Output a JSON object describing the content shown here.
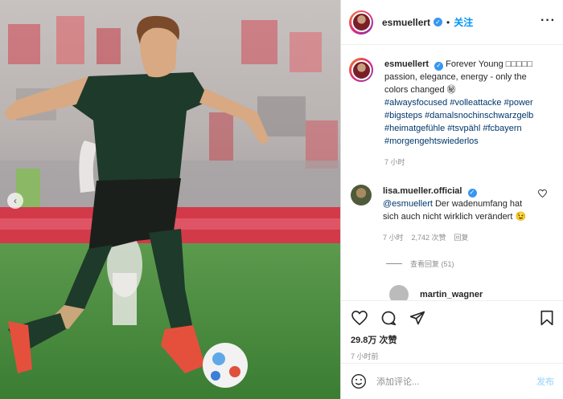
{
  "post_header": {
    "username": "esmuellert",
    "follow_label": "关注",
    "separator": "•",
    "more": "···"
  },
  "caption": {
    "username": "esmuellert",
    "text": "Forever Young □□□□□ passion, elegance, energy - only the colors changed ㊙",
    "hashtags": [
      "#alwaysfocused",
      "#volleattacke",
      "#power",
      "#bigsteps",
      "#damalsnochinschwarzgelb",
      "#heimatgefühle",
      "#tsvpähl",
      "#fcbayern",
      "#morgengehtswiederlos"
    ],
    "time": "7 小时"
  },
  "comment": {
    "username": "lisa.mueller.official",
    "mention": "@esmuellert",
    "text": "Der wadenumfang hat sich auch nicht wirklich verändert 😉",
    "time": "7 小时",
    "likes": "2,742 次赞",
    "reply": "回复",
    "view_replies": "查看回复 (51)"
  },
  "next_comment": {
    "username": "martin_wagner"
  },
  "actions": {
    "likes": "29.8万 次赞",
    "time_ago": "7 小时前"
  },
  "add_comment": {
    "placeholder": "添加评论...",
    "post_label": "发布"
  },
  "colors": {
    "accent": "#0095f6",
    "verified": "#3897f0",
    "jersey": "#1e3a2a",
    "pitch": "#3d8a38"
  }
}
